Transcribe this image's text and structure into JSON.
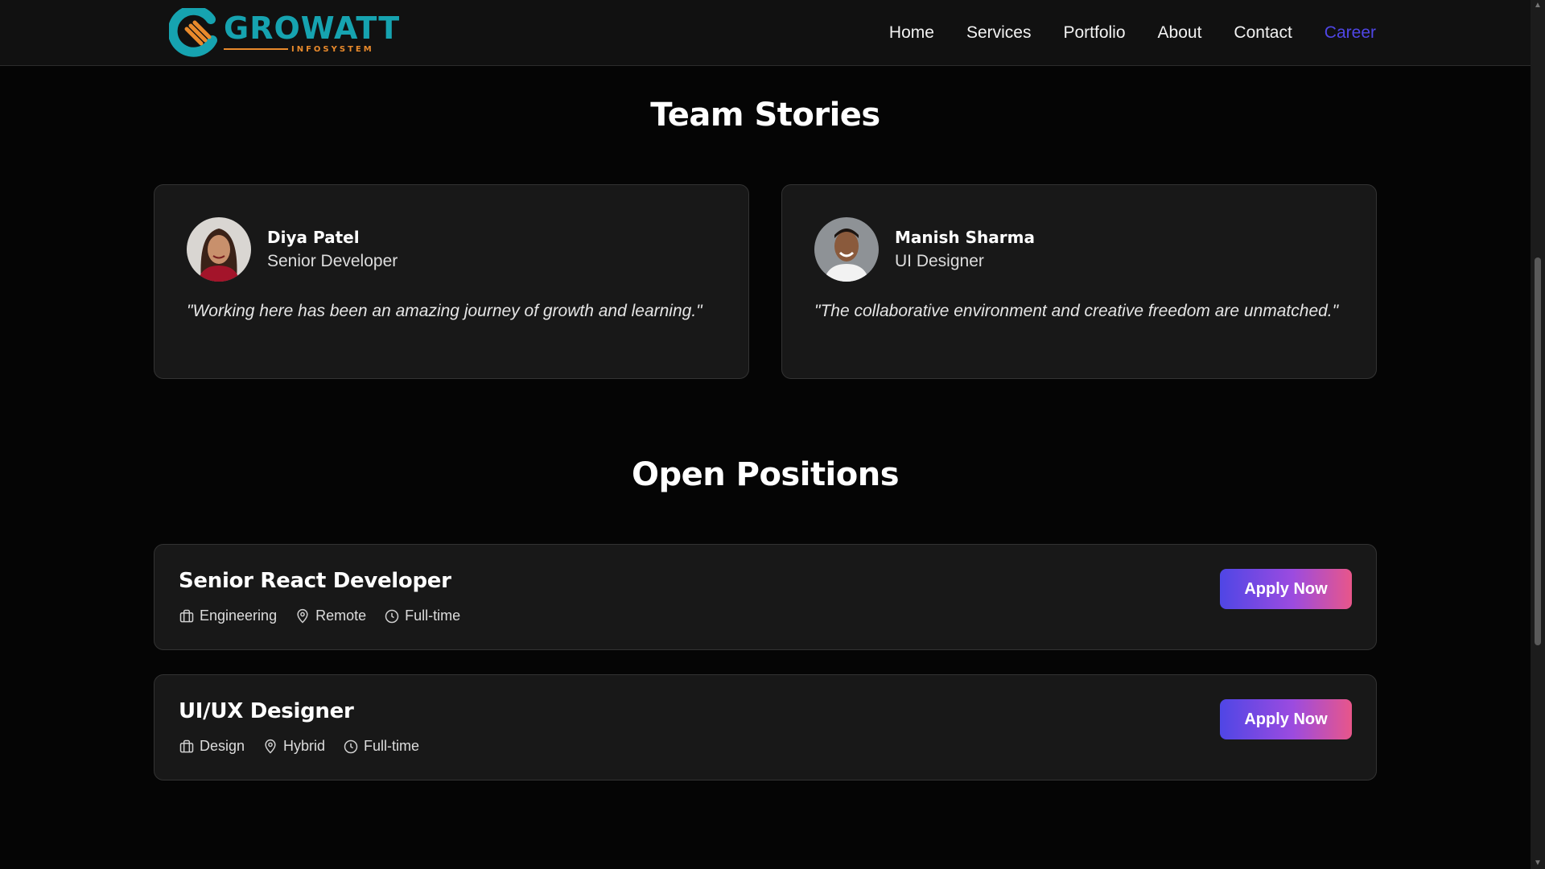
{
  "brand": {
    "name": "GROWATT",
    "sub": "INFOSYSTEM",
    "primary": "#16a3b0",
    "accent": "#e98a2c"
  },
  "nav": {
    "items": [
      {
        "label": "Home"
      },
      {
        "label": "Services"
      },
      {
        "label": "Portfolio"
      },
      {
        "label": "About"
      },
      {
        "label": "Contact"
      },
      {
        "label": "Career",
        "active": true
      }
    ],
    "active_color": "#4f46e5"
  },
  "team_stories": {
    "title": "Team Stories",
    "stories": [
      {
        "name": "Diya Patel",
        "role": "Senior Developer",
        "quote": "\"Working here has been an amazing journey of growth and learning.\""
      },
      {
        "name": "Manish Sharma",
        "role": "UI Designer",
        "quote": "\"The collaborative environment and creative freedom are unmatched.\""
      }
    ]
  },
  "open_positions": {
    "title": "Open Positions",
    "jobs": [
      {
        "title": "Senior React Developer",
        "department": "Engineering",
        "location": "Remote",
        "type": "Full-time",
        "cta": "Apply Now"
      },
      {
        "title": "UI/UX Designer",
        "department": "Design",
        "location": "Hybrid",
        "type": "Full-time",
        "cta": "Apply Now"
      }
    ]
  },
  "icons": {
    "department": "briefcase-icon",
    "location": "map-pin-icon",
    "type": "clock-icon"
  }
}
